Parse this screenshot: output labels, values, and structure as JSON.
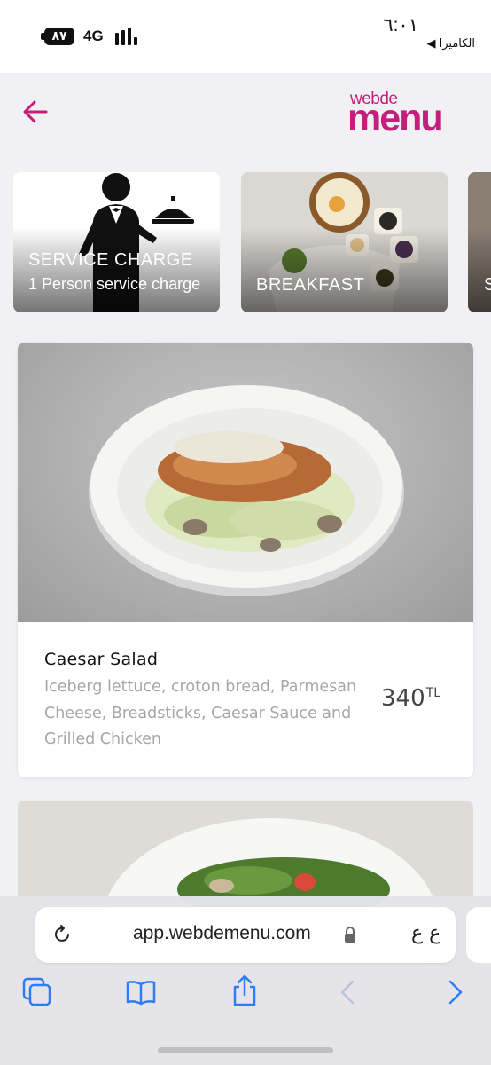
{
  "status_bar": {
    "battery": "٨٧",
    "network": "4G",
    "time": "٦:٠١",
    "back_to_app": "◀ الكاميرا"
  },
  "header": {
    "back_icon": "arrow-left-icon",
    "logo_top": "webde",
    "logo_main": "menu",
    "brand_color": "#c41f7a"
  },
  "categories": [
    {
      "title": "SERVICE CHARGE",
      "subtitle": "1 Person service charge"
    },
    {
      "title": "BREAKFAST"
    },
    {
      "title": "S"
    }
  ],
  "product": {
    "name": "Caesar Salad",
    "description": "Iceberg lettuce, croton bread, Parmesan Cheese, Breadsticks, Caesar Sauce and Grilled Chicken",
    "price": "340",
    "currency": "TL"
  },
  "browser": {
    "url": "app.webdemenu.com",
    "text_size_button": "ع ع",
    "icons": [
      "reload-icon",
      "lock-icon",
      "tabs-icon",
      "bookmarks-icon",
      "share-icon",
      "back-icon",
      "forward-icon"
    ]
  }
}
